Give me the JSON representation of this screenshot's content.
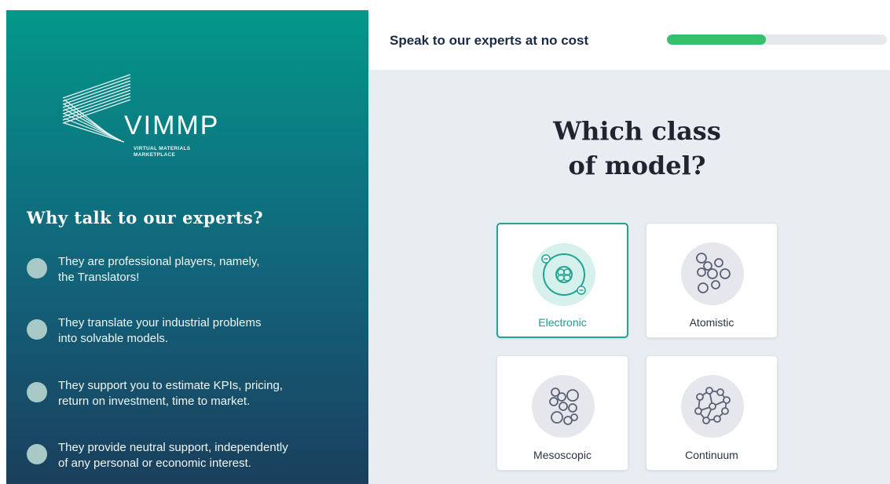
{
  "brand": {
    "name": "VIMMP",
    "subtitle_line1": "VIRTUAL MATERIALS",
    "subtitle_line2": "MARKETPLACE"
  },
  "sidebar": {
    "title": "Why talk to our experts?",
    "reasons": [
      {
        "line1": "They are professional players, namely,",
        "line2": "the Translators!"
      },
      {
        "line1": "They translate your industrial problems",
        "line2": "into solvable models."
      },
      {
        "line1": "They support you to estimate KPIs, pricing,",
        "line2": "return on investment, time to market."
      },
      {
        "line1": "They provide neutral support, independently",
        "line2": "of any personal or economic interest."
      }
    ]
  },
  "header": {
    "title": "Speak to our experts at no cost",
    "progress_percent": 45,
    "colors": {
      "progress_fill": "#35c16c",
      "progress_track": "#e5e9ee"
    }
  },
  "question": {
    "line1": "Which class",
    "line2": "of model?"
  },
  "options": [
    {
      "label": "Electronic",
      "icon": "electron-orbit-icon",
      "selected": true
    },
    {
      "label": "Atomistic",
      "icon": "atoms-icon",
      "selected": false
    },
    {
      "label": "Mesoscopic",
      "icon": "molecule-cluster-icon",
      "selected": false
    },
    {
      "label": "Continuum",
      "icon": "network-icon",
      "selected": false
    }
  ],
  "colors": {
    "accent": "#1fa596",
    "panel_top": "#03988a",
    "panel_bottom": "#1a3f5c"
  }
}
